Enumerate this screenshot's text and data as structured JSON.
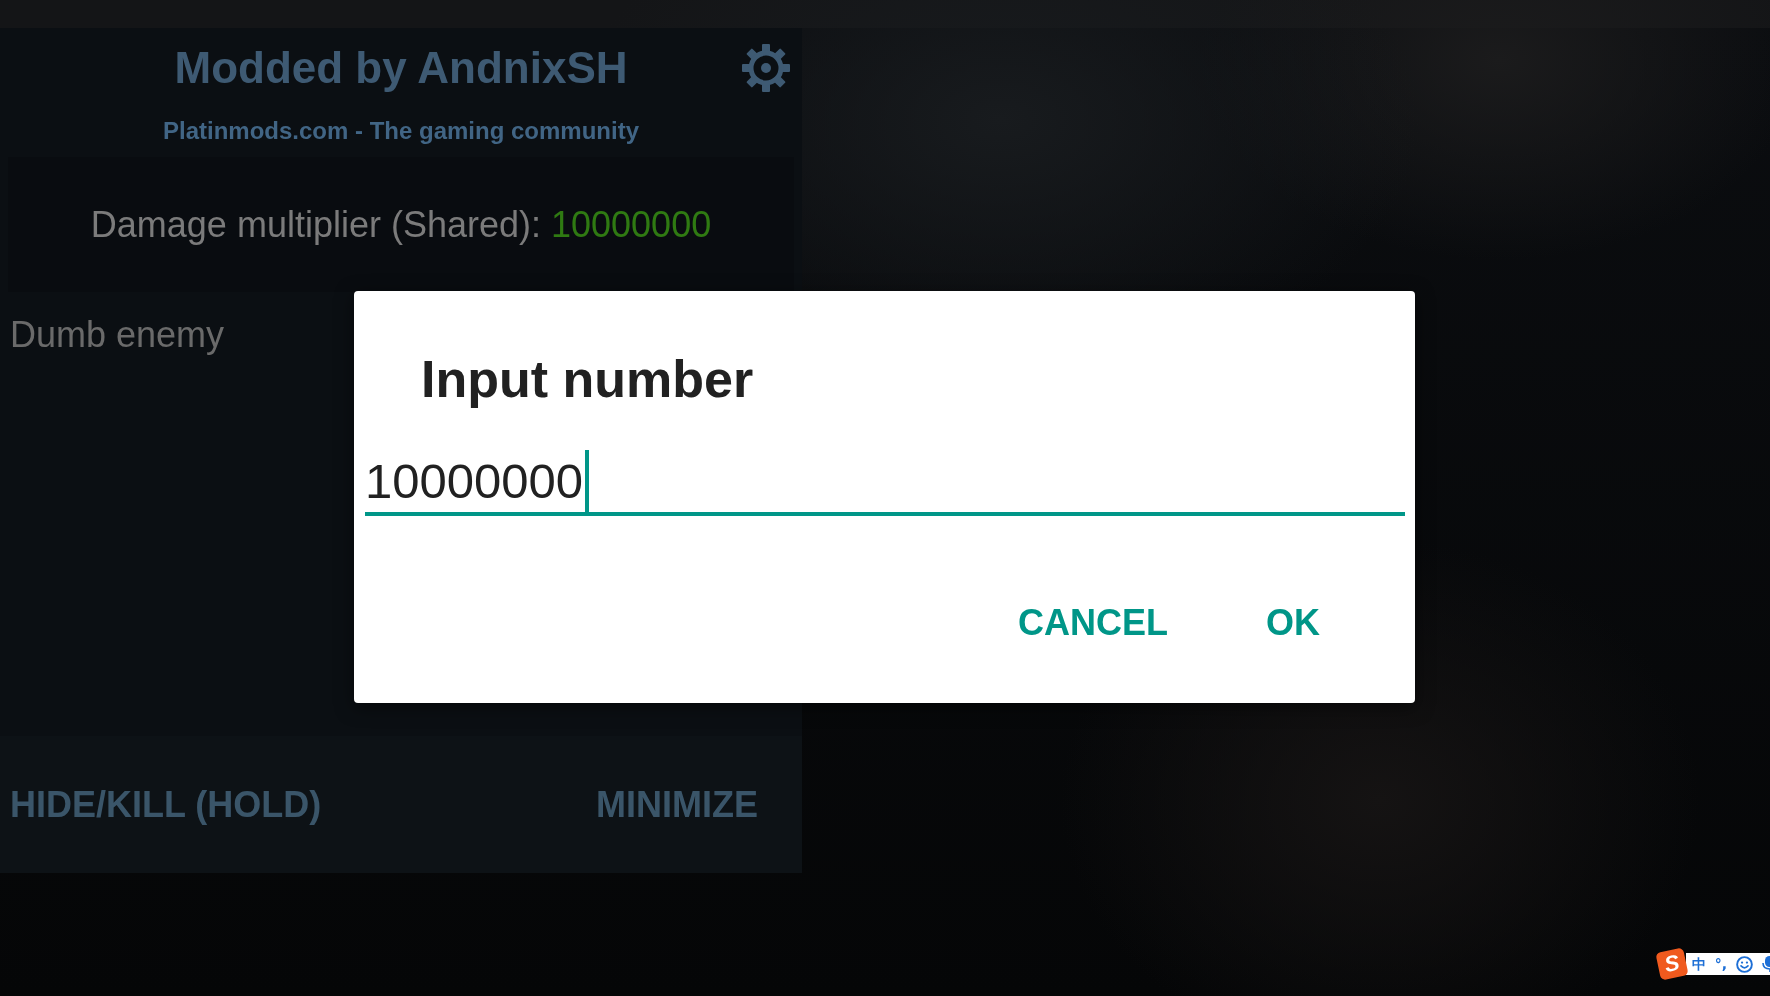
{
  "mod_menu": {
    "title": "Modded by AndnixSH",
    "subtitle": "Platinmods.com - The gaming community",
    "features": [
      {
        "kind": "value",
        "label": "Damage multiplier (Shared):",
        "value": "10000000"
      },
      {
        "kind": "text",
        "label": "Dumb enemy"
      }
    ],
    "buttons": [
      "HIDE/KILL (HOLD)",
      "MINIMIZE"
    ]
  },
  "dialog": {
    "title": "Input number",
    "value": "10000000",
    "focused": true,
    "buttons": [
      "CANCEL",
      "OK"
    ]
  },
  "ime_bar": {
    "logo": "S",
    "mode": "中",
    "punctuation": "°,"
  }
}
